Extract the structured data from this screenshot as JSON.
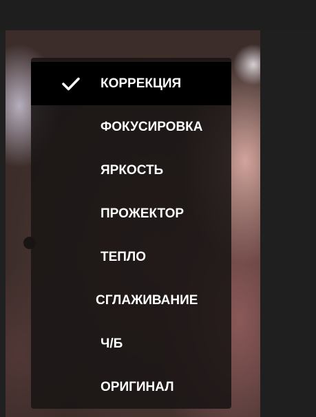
{
  "effects_menu": {
    "selected_index": 0,
    "items": [
      {
        "label": "КОРРЕКЦИЯ",
        "selected": true
      },
      {
        "label": "ФОКУСИРОВКА",
        "selected": false
      },
      {
        "label": "ЯРКОСТЬ",
        "selected": false
      },
      {
        "label": "ПРОЖЕКТОР",
        "selected": false
      },
      {
        "label": "ТЕПЛО",
        "selected": false
      },
      {
        "label": "СГЛАЖИВАНИЕ",
        "selected": false
      },
      {
        "label": "Ч/Б",
        "selected": false
      },
      {
        "label": "ОРИГИНАЛ",
        "selected": false
      }
    ],
    "check_icon": "checkmark-icon"
  },
  "colors": {
    "menu_background": "#191414",
    "selected_background": "#000000",
    "text": "#ffffff"
  }
}
